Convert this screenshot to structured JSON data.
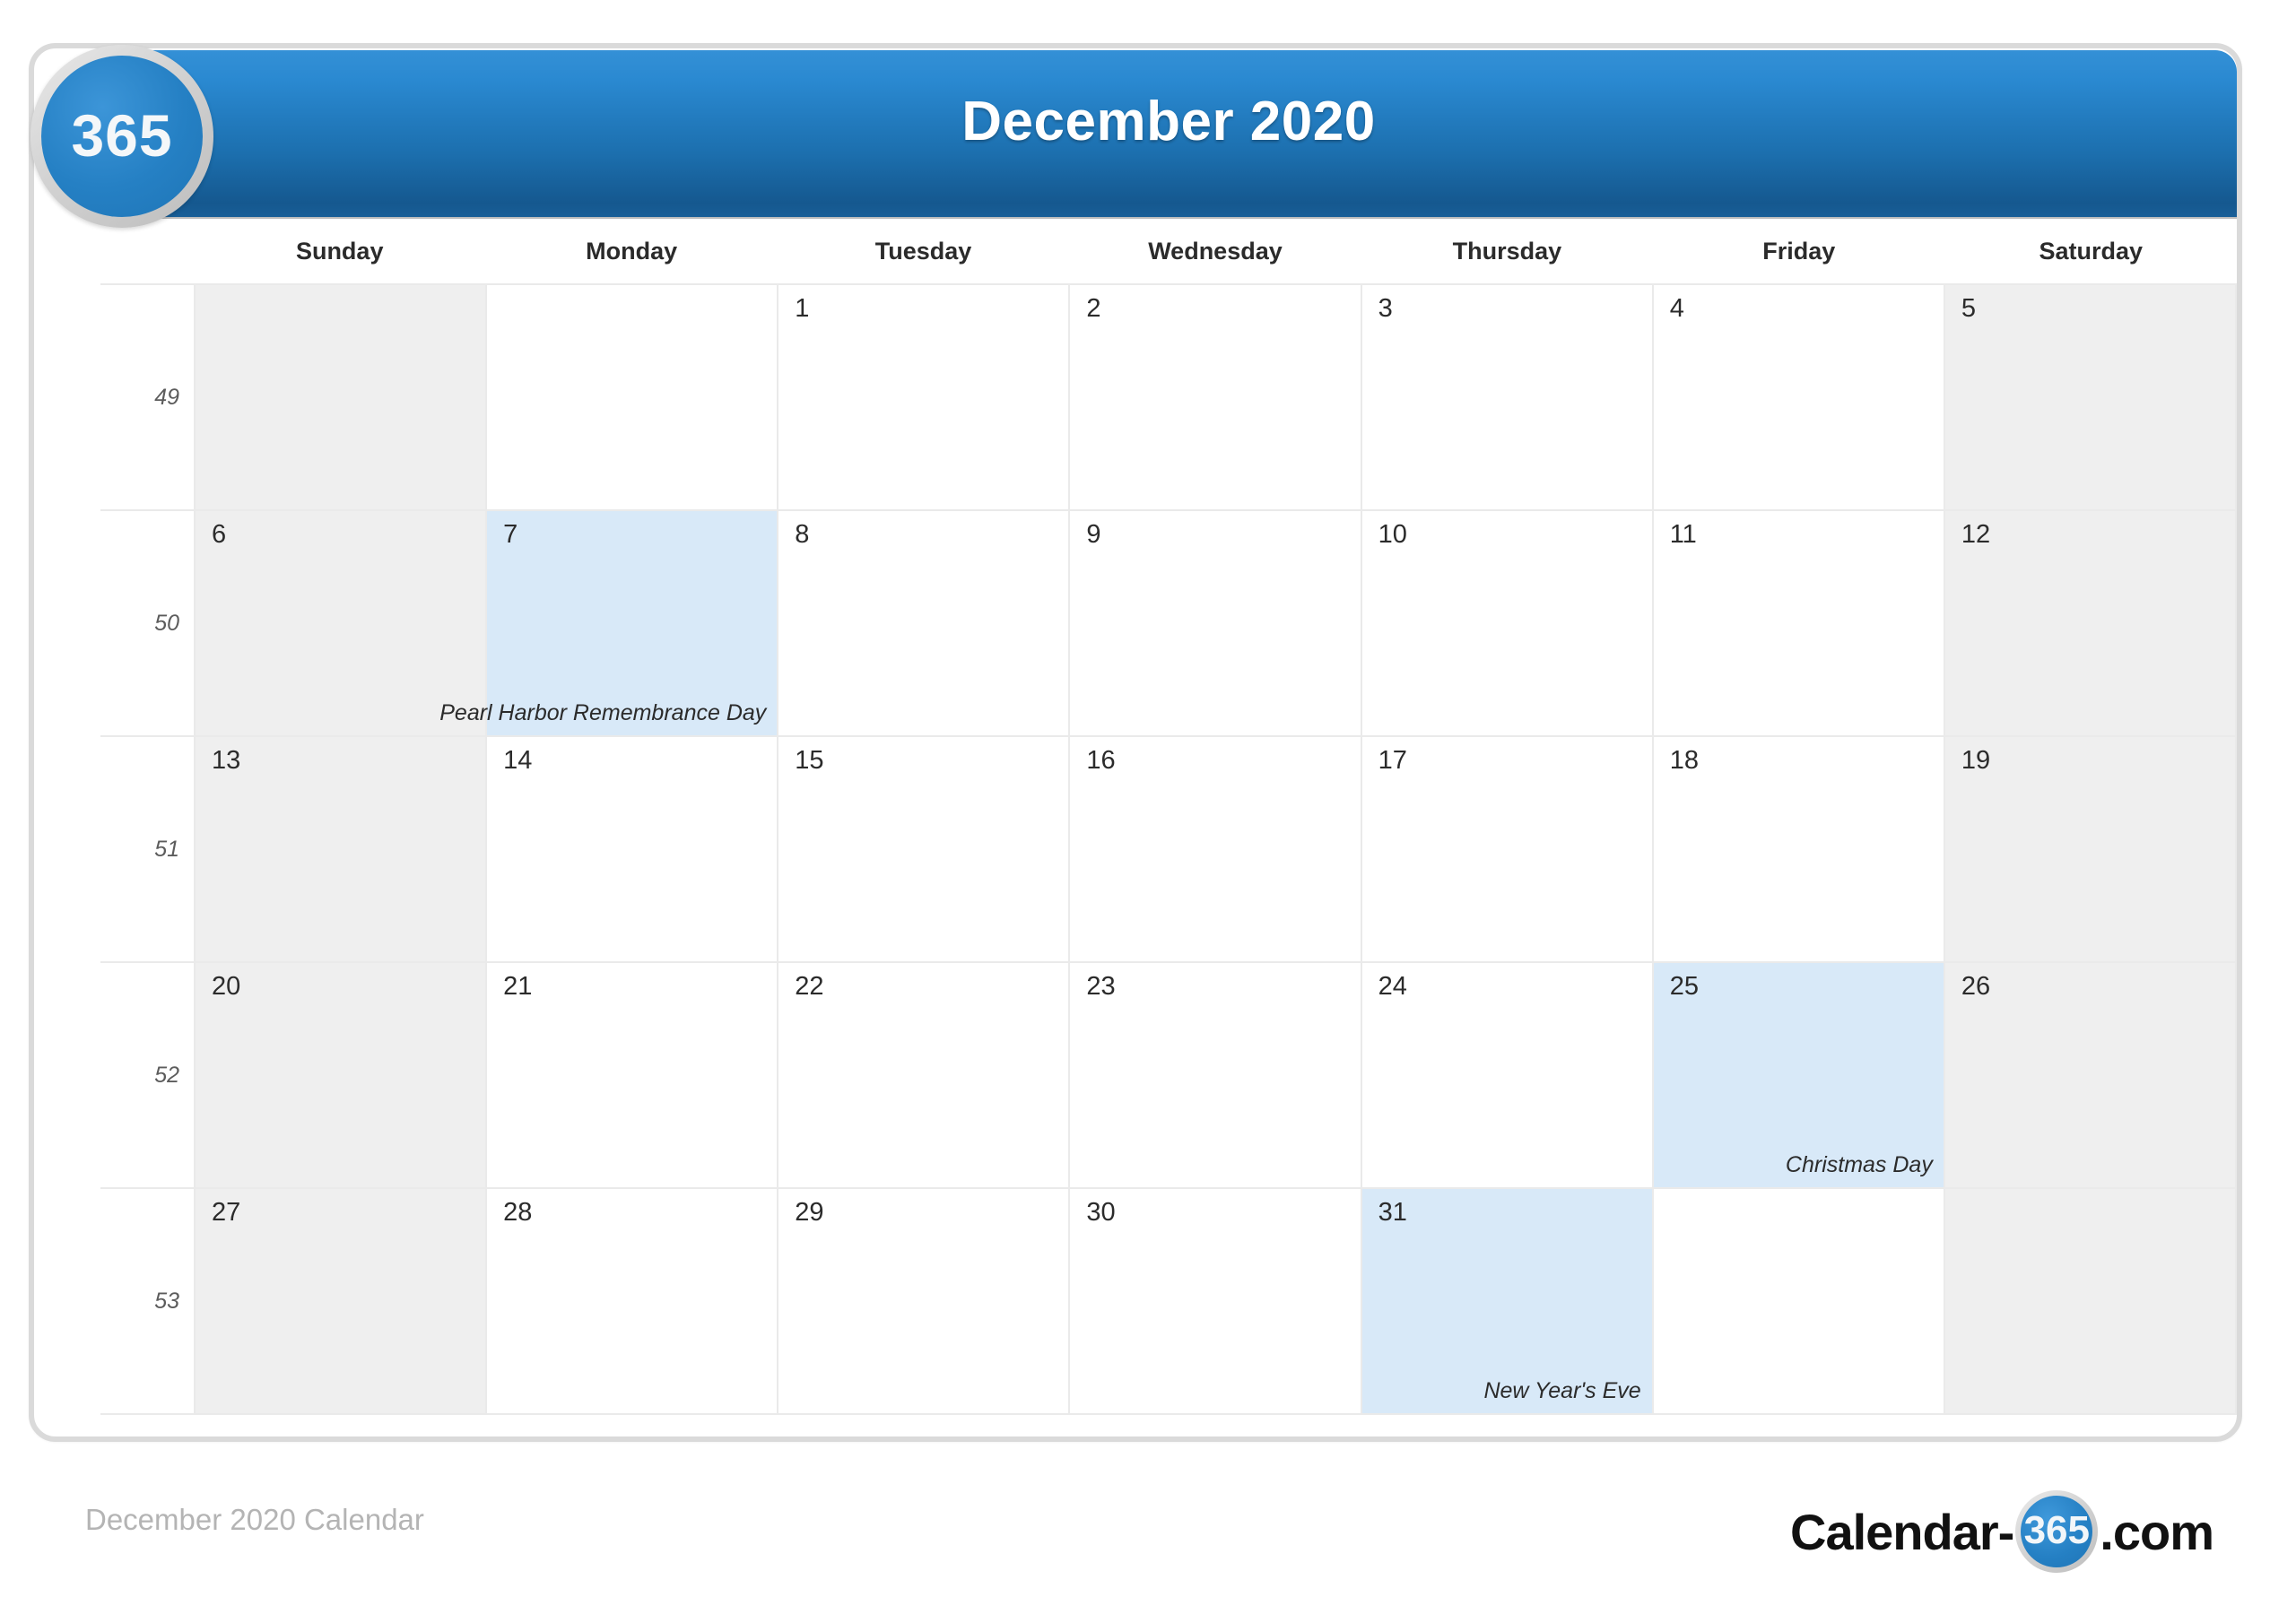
{
  "brand": {
    "badge_text": "365",
    "logo_prefix": "Calendar-",
    "logo_circle": "365",
    "logo_suffix": ".com",
    "accent_blue": "#2580c4",
    "header_gradient_top": "#3490d6",
    "header_gradient_bottom": "#15588f",
    "highlight_blue": "#d8e9f8",
    "weekend_gray": "#efefef"
  },
  "header": {
    "title": "December 2020"
  },
  "calendar": {
    "month": "December",
    "year": "2020",
    "weekday_headers": [
      "Sunday",
      "Monday",
      "Tuesday",
      "Wednesday",
      "Thursday",
      "Friday",
      "Saturday"
    ],
    "week_numbers": [
      "49",
      "50",
      "51",
      "52",
      "53"
    ],
    "weeks": [
      {
        "week_number": "49",
        "days": [
          {
            "num": "",
            "holiday": "",
            "weekend": true,
            "highlight": false,
            "empty": true
          },
          {
            "num": "",
            "holiday": "",
            "weekend": false,
            "highlight": false,
            "empty": true
          },
          {
            "num": "1",
            "holiday": "",
            "weekend": false,
            "highlight": false,
            "empty": false
          },
          {
            "num": "2",
            "holiday": "",
            "weekend": false,
            "highlight": false,
            "empty": false
          },
          {
            "num": "3",
            "holiday": "",
            "weekend": false,
            "highlight": false,
            "empty": false
          },
          {
            "num": "4",
            "holiday": "",
            "weekend": false,
            "highlight": false,
            "empty": false
          },
          {
            "num": "5",
            "holiday": "",
            "weekend": true,
            "highlight": false,
            "empty": false
          }
        ]
      },
      {
        "week_number": "50",
        "days": [
          {
            "num": "6",
            "holiday": "",
            "weekend": true,
            "highlight": false,
            "empty": false
          },
          {
            "num": "7",
            "holiday": "Pearl Harbor Remembrance Day",
            "weekend": false,
            "highlight": true,
            "empty": false
          },
          {
            "num": "8",
            "holiday": "",
            "weekend": false,
            "highlight": false,
            "empty": false
          },
          {
            "num": "9",
            "holiday": "",
            "weekend": false,
            "highlight": false,
            "empty": false
          },
          {
            "num": "10",
            "holiday": "",
            "weekend": false,
            "highlight": false,
            "empty": false
          },
          {
            "num": "11",
            "holiday": "",
            "weekend": false,
            "highlight": false,
            "empty": false
          },
          {
            "num": "12",
            "holiday": "",
            "weekend": true,
            "highlight": false,
            "empty": false
          }
        ]
      },
      {
        "week_number": "51",
        "days": [
          {
            "num": "13",
            "holiday": "",
            "weekend": true,
            "highlight": false,
            "empty": false
          },
          {
            "num": "14",
            "holiday": "",
            "weekend": false,
            "highlight": false,
            "empty": false
          },
          {
            "num": "15",
            "holiday": "",
            "weekend": false,
            "highlight": false,
            "empty": false
          },
          {
            "num": "16",
            "holiday": "",
            "weekend": false,
            "highlight": false,
            "empty": false
          },
          {
            "num": "17",
            "holiday": "",
            "weekend": false,
            "highlight": false,
            "empty": false
          },
          {
            "num": "18",
            "holiday": "",
            "weekend": false,
            "highlight": false,
            "empty": false
          },
          {
            "num": "19",
            "holiday": "",
            "weekend": true,
            "highlight": false,
            "empty": false
          }
        ]
      },
      {
        "week_number": "52",
        "days": [
          {
            "num": "20",
            "holiday": "",
            "weekend": true,
            "highlight": false,
            "empty": false
          },
          {
            "num": "21",
            "holiday": "",
            "weekend": false,
            "highlight": false,
            "empty": false
          },
          {
            "num": "22",
            "holiday": "",
            "weekend": false,
            "highlight": false,
            "empty": false
          },
          {
            "num": "23",
            "holiday": "",
            "weekend": false,
            "highlight": false,
            "empty": false
          },
          {
            "num": "24",
            "holiday": "",
            "weekend": false,
            "highlight": false,
            "empty": false
          },
          {
            "num": "25",
            "holiday": "Christmas Day",
            "weekend": false,
            "highlight": true,
            "empty": false
          },
          {
            "num": "26",
            "holiday": "",
            "weekend": true,
            "highlight": false,
            "empty": false
          }
        ]
      },
      {
        "week_number": "53",
        "days": [
          {
            "num": "27",
            "holiday": "",
            "weekend": true,
            "highlight": false,
            "empty": false
          },
          {
            "num": "28",
            "holiday": "",
            "weekend": false,
            "highlight": false,
            "empty": false
          },
          {
            "num": "29",
            "holiday": "",
            "weekend": false,
            "highlight": false,
            "empty": false
          },
          {
            "num": "30",
            "holiday": "",
            "weekend": false,
            "highlight": false,
            "empty": false
          },
          {
            "num": "31",
            "holiday": "New Year's Eve",
            "weekend": false,
            "highlight": true,
            "empty": false
          },
          {
            "num": "",
            "holiday": "",
            "weekend": false,
            "highlight": false,
            "empty": true
          },
          {
            "num": "",
            "holiday": "",
            "weekend": true,
            "highlight": false,
            "empty": true
          }
        ]
      }
    ],
    "watermark_text": "365"
  },
  "footer": {
    "caption": "December 2020 Calendar"
  }
}
